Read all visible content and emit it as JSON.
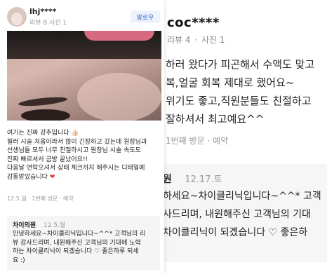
{
  "back_review": {
    "username": "coc****",
    "meta_review": "리뷰 4",
    "meta_sep": "·",
    "meta_photo": "사진 1",
    "lines": [
      "하러 왔다가 피곤해서 수액도 맞고",
      "복,얼굴 회복 제대로 했어요~",
      "위기도 좋고,직원분들도 친절하고",
      "잘하셔서 최고예요^^"
    ],
    "visit": "1번째 방문 · 예약",
    "reply": {
      "name": "원",
      "date": "12.17.토",
      "lines": [
        "하세요~차이클리닉입니다~^^* 고객",
        "사드리며, 내원해주신 고객님의 기대",
        "차이클리닉이 되겠습니다 ♡ 좋은하"
      ]
    }
  },
  "front_review": {
    "username": "lhj****",
    "meta": "리뷰 8  사진 1",
    "follow_label": "팔로우",
    "text_lines": [
      "여기는 진짜 강추입니다 👍🏻",
      "필러 시술 처음이라서 많이 긴장하고 갔는데 원장님과",
      "선생님들 모두 너무 친절하시고 원장님 시술 속도도",
      "진짜 빠르셔서 금방 끝났어요!!",
      "다음날 연락오셔서 상태 체크까지 해주시는 디테일에",
      "감동받았습니다"
    ],
    "heart": "❤",
    "visit": "12.5.월 · 1번째 방문 · 예약",
    "reply": {
      "name": "차이의원",
      "date": "12.5.월",
      "lines": [
        "안녕하세요~차이클리닉입니다~^^* 고객님의 리",
        "뷰 감사드리며, 내원해주신 고객님의 기대에 노력",
        "하는 차이클리닉이 되겠습니다 ♡ 좋은하루 되세",
        "요 :)"
      ]
    }
  }
}
